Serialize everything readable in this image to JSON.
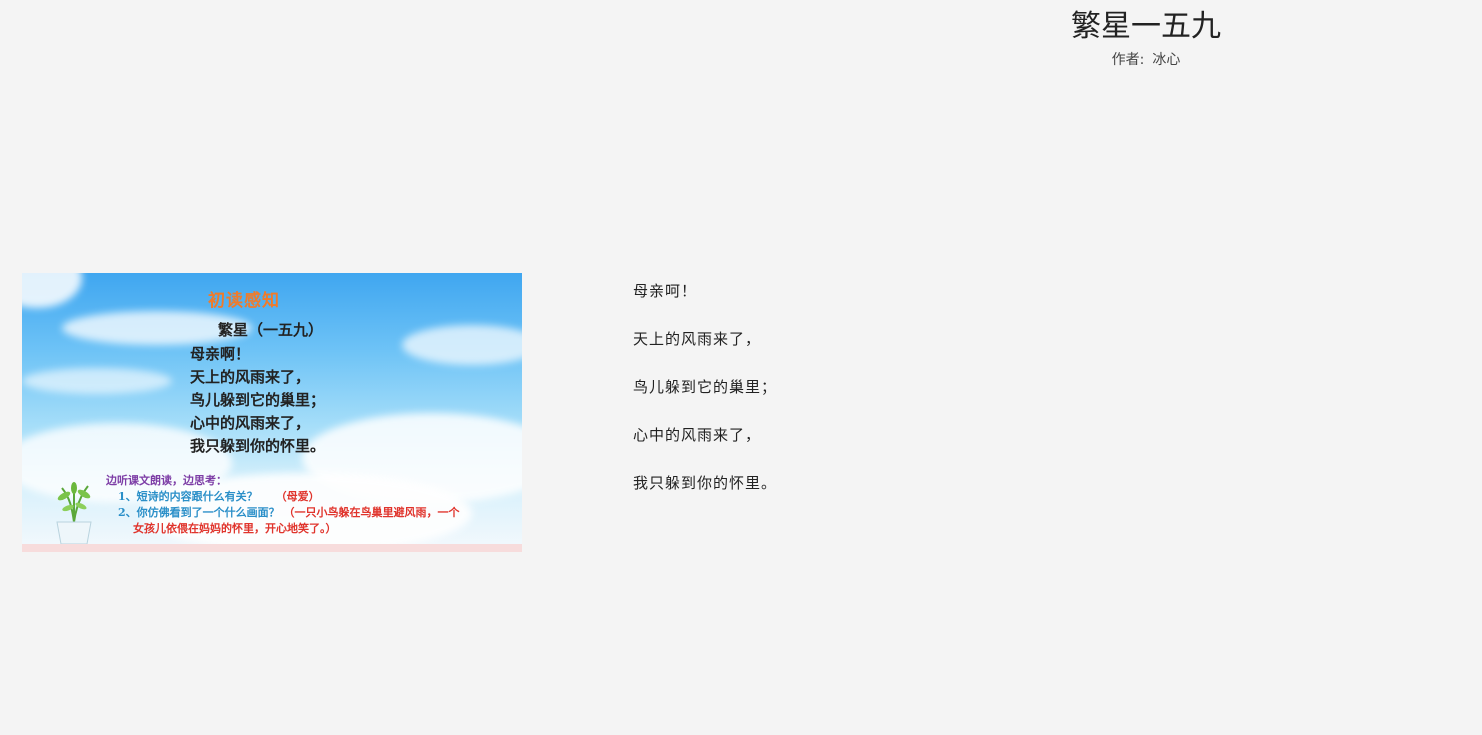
{
  "article": {
    "title": "繁星一五九",
    "author_label": "作者:",
    "author_name": "冰心"
  },
  "slide": {
    "heading": "初读感知",
    "poem_title": "繁星（一五九）",
    "lines": [
      "母亲啊！",
      "天上的风雨来了，",
      "鸟儿躲到它的巢里；",
      "心中的风雨来了，",
      "我只躲到你的怀里。"
    ],
    "prompt": "边听课文朗读，边思考：",
    "q1": "1、短诗的内容跟什么有关？",
    "a1": "（母爱）",
    "q2": "2、你仿佛看到了一个什么画面？",
    "a2_part1": "（一只小鸟躲在鸟巢里避风雨，一个",
    "a2_part2": "女孩儿依偎在妈妈的怀里，开心地笑了。）"
  },
  "poem": {
    "lines": [
      "母亲呵！",
      "天上的风雨来了，",
      "鸟儿躲到它的巢里；",
      "心中的风雨来了，",
      "我只躲到你的怀里。"
    ]
  },
  "colors": {
    "background": "#f4f4f4",
    "slide_heading": "#f07b2a",
    "question_blue": "#2a8fc8",
    "answer_red": "#e0342c",
    "prompt_purple": "#7d3da6"
  }
}
